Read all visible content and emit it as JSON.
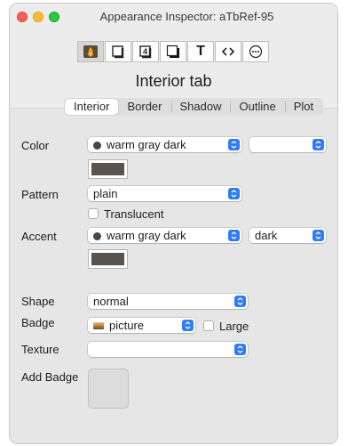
{
  "window": {
    "title": "Appearance Inspector: aTbRef-95"
  },
  "toolbar": {
    "buttons": [
      {
        "name": "interior",
        "icon": "flame-icon"
      },
      {
        "name": "border",
        "icon": "border-icon"
      },
      {
        "name": "text-badge",
        "icon": "numbered-box-icon",
        "text": "4"
      },
      {
        "name": "shadow",
        "icon": "shadow-icon"
      },
      {
        "name": "text",
        "icon": "text-icon",
        "text": "T"
      },
      {
        "name": "code",
        "icon": "angle-brackets-icon",
        "text": "<>"
      },
      {
        "name": "more",
        "icon": "ellipsis-circle-icon"
      }
    ]
  },
  "heading": "Interior tab",
  "tabs": [
    "Interior",
    "Border",
    "Shadow",
    "Outline",
    "Plot"
  ],
  "active_tab": "Interior",
  "color": {
    "label": "Color",
    "value": "warm gray dark",
    "secondary_value": ""
  },
  "pattern": {
    "label": "Pattern",
    "value": "plain"
  },
  "translucent": {
    "label": "Translucent",
    "checked": false
  },
  "accent": {
    "label": "Accent",
    "value": "warm gray dark",
    "secondary_value": "dark"
  },
  "shape": {
    "label": "Shape",
    "value": "normal"
  },
  "badge": {
    "label": "Badge",
    "value": "picture",
    "large_label": "Large",
    "large_checked": false
  },
  "texture": {
    "label": "Texture",
    "value": ""
  },
  "add_badge": {
    "label": "Add Badge"
  },
  "colors": {
    "swatch": "#5a524c",
    "accent": "#2f7cf6"
  }
}
